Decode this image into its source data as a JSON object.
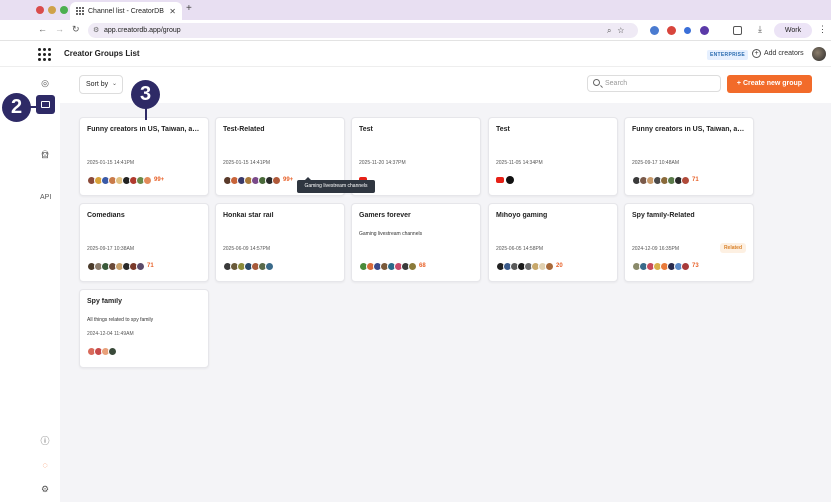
{
  "browser": {
    "tab_title": "Channel list - CreatorDB",
    "url": "app.creatordb.app/group",
    "profile": "Work"
  },
  "header": {
    "title": "Creator Groups List",
    "plan_badge": "ENTERPRISE",
    "add_creators": "Add creators"
  },
  "sidebar": {
    "api_label": "API"
  },
  "annotations": {
    "marker_2": "2",
    "marker_3": "3"
  },
  "toolbar": {
    "sort_label": "Sort by",
    "search_placeholder": "Search",
    "create_label": "+ Create new group"
  },
  "colors": {
    "accent": "#f26b2a",
    "nav_active": "#2e2a66",
    "count": "#e8622a",
    "related_badge_bg": "#fdf0e2"
  },
  "groups": [
    {
      "title": "Funny creators in US, Taiwan, and ...",
      "date": "2025-01-15 14:41PM",
      "count": "99+"
    },
    {
      "title": "Test-Related",
      "date": "2025-01-15 14:41PM",
      "count": "99+"
    },
    {
      "title": "Test",
      "date": "2025-11-20 14:37PM",
      "count": ""
    },
    {
      "title": "Test",
      "date": "2025-11-05 14:34PM",
      "count": ""
    },
    {
      "title": "Funny creators in US, Taiwan, and ...",
      "date": "2025-09-17 10:48AM",
      "count": "71"
    },
    {
      "title": "Comedians",
      "date": "2025-09-17 10:38AM",
      "count": "71"
    },
    {
      "title": "Honkai star rail",
      "date": "2025-06-09 14:57PM",
      "count": ""
    },
    {
      "title": "Gamers forever",
      "description": "Gaming livestream channels",
      "count": "68"
    },
    {
      "title": "Mihoyo gaming",
      "date": "2025-06-05 14:58PM",
      "count": "20"
    },
    {
      "title": "Spy family-Related",
      "date": "2024-12-09 16:35PM",
      "badge": "Related",
      "count": "73"
    },
    {
      "title": "Spy family",
      "description": "All things related to spy family",
      "date": "2024-12-04 11:49AM",
      "count": ""
    }
  ],
  "tooltip": "Gaming livestream channels"
}
